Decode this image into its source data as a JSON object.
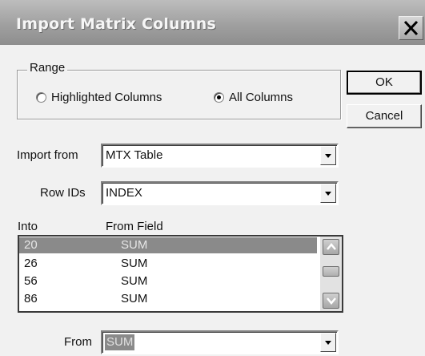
{
  "window": {
    "title": "Import Matrix Columns"
  },
  "range": {
    "label": "Range",
    "options": [
      {
        "label": "Highlighted Columns",
        "selected": false
      },
      {
        "label": "All Columns",
        "selected": true
      }
    ]
  },
  "buttons": {
    "ok": "OK",
    "cancel": "Cancel"
  },
  "import_from": {
    "label": "Import from",
    "value": "MTX Table"
  },
  "row_ids": {
    "label": "Row IDs",
    "value": "INDEX"
  },
  "list": {
    "headers": [
      "Into",
      "From Field"
    ],
    "selected_index": 0,
    "rows": [
      {
        "into": "20",
        "from": "SUM"
      },
      {
        "into": "26",
        "from": "SUM"
      },
      {
        "into": "56",
        "from": "SUM"
      },
      {
        "into": "86",
        "from": "SUM"
      }
    ]
  },
  "from": {
    "label": "From",
    "value": "SUM"
  },
  "icons": {
    "close": "close-icon",
    "combo_arrow": "chevron-down-icon",
    "scroll_up": "scroll-up-arrow-icon",
    "scroll_down": "scroll-down-arrow-icon"
  }
}
